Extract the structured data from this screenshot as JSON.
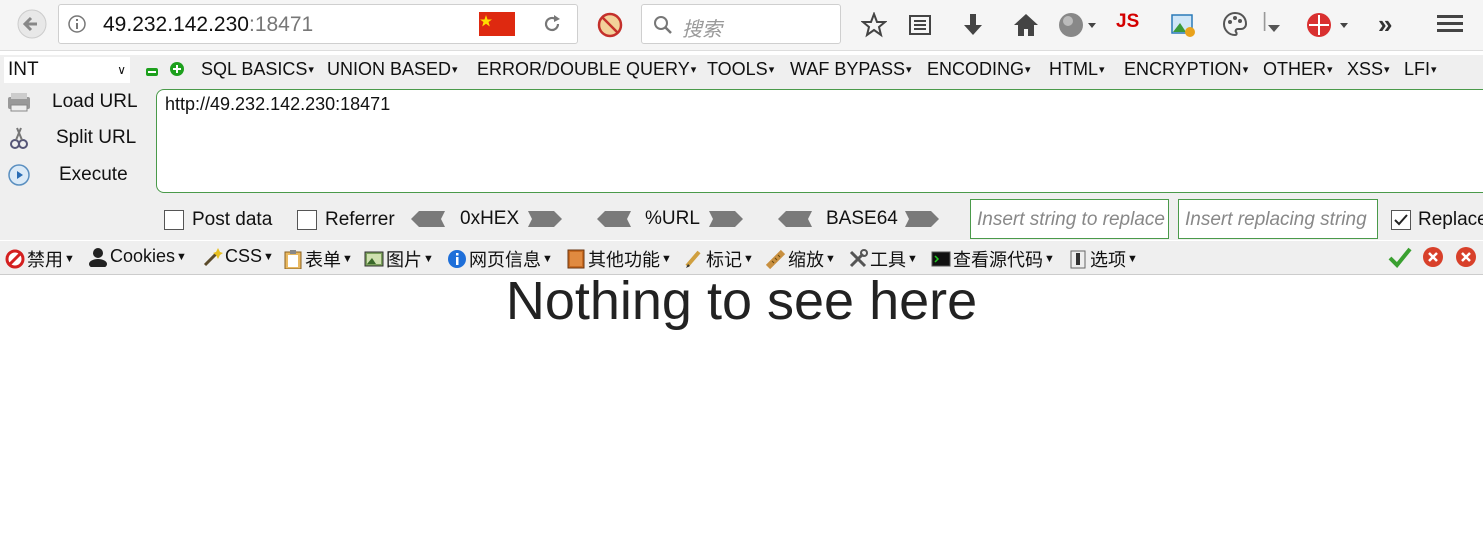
{
  "browser": {
    "url_host": "49.232.142.230",
    "url_port": ":18471",
    "search_placeholder": "搜索",
    "toolbar_icons": [
      "back-icon",
      "info-icon",
      "flag-cn-icon",
      "reload-icon",
      "noscript-icon",
      "search-icon",
      "star-icon",
      "reader-icon",
      "download-icon",
      "home-icon",
      "globe-icon",
      "js-icon",
      "image-icon",
      "palette-icon",
      "hackbar-icon",
      "overflow-icon",
      "menu-icon"
    ]
  },
  "hackbar": {
    "type_select": "INT",
    "menus": [
      "SQL BASICS",
      "UNION BASED",
      "ERROR/DOUBLE QUERY",
      "TOOLS",
      "WAF BYPASS",
      "ENCODING",
      "HTML",
      "ENCRYPTION",
      "OTHER",
      "XSS",
      "LFI"
    ],
    "buttons": {
      "load": "Load URL",
      "split": "Split URL",
      "execute": "Execute"
    },
    "url_value": "http://49.232.142.230:18471",
    "options": {
      "post": "Post data",
      "referrer": "Referrer",
      "hex": "0xHEX",
      "url": "%URL",
      "base64": "BASE64",
      "replace": "Replace"
    },
    "replace_placeholder": "Insert string to replace",
    "replacing_placeholder": "Insert replacing string"
  },
  "webdev": {
    "items": [
      "禁用",
      "Cookies",
      "CSS",
      "表单",
      "图片",
      "网页信息",
      "其他功能",
      "标记",
      "缩放",
      "工具",
      "查看源代码",
      "选项"
    ]
  },
  "page": {
    "heading": "Nothing to see here"
  },
  "colors": {
    "accent_green": "#4a9a4a",
    "js_red": "#d40000"
  }
}
